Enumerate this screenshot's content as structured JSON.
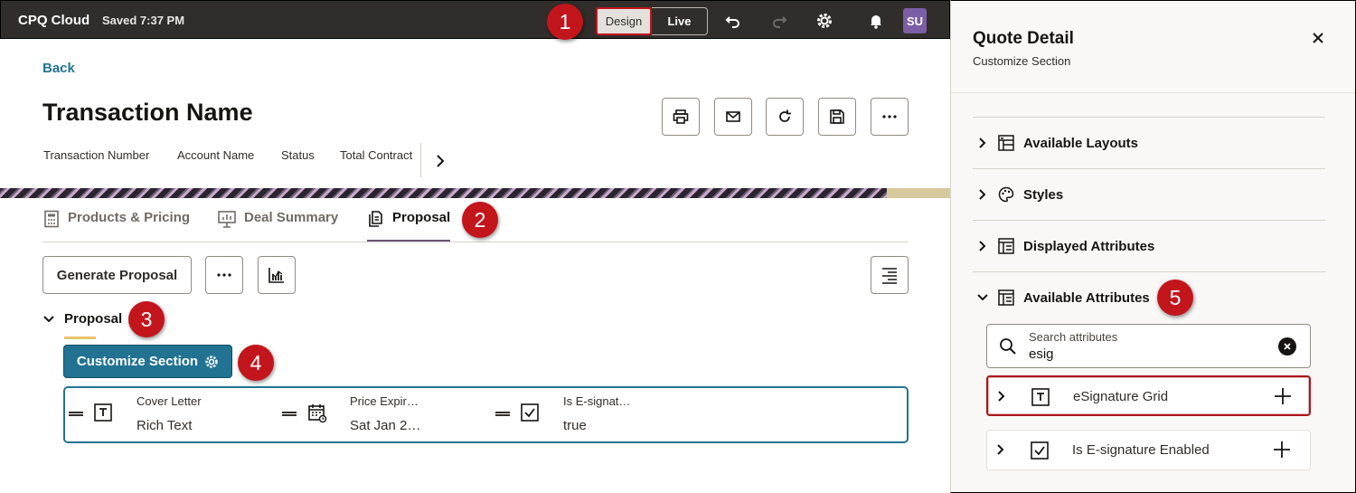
{
  "topbar": {
    "app_name": "CPQ Cloud",
    "saved_status": "Saved 7:37 PM",
    "design_label": "Design",
    "live_label": "Live",
    "avatar_initials": "SU",
    "icons": [
      "undo-icon",
      "redo-icon",
      "settings-icon",
      "bell-icon"
    ]
  },
  "badges": {
    "b1": "1",
    "b2": "2",
    "b3": "3",
    "b4": "4",
    "b5": "5"
  },
  "main": {
    "back_label": "Back",
    "title": "Transaction Name",
    "header_actions": [
      "print-icon",
      "email-icon",
      "refresh-icon",
      "save-icon",
      "more-icon"
    ],
    "meta_fields": [
      "Transaction Number",
      "Account Name",
      "Status",
      "Total Contract"
    ],
    "tabs": [
      {
        "label": "Products & Pricing",
        "icon": "calculator-icon"
      },
      {
        "label": "Deal Summary",
        "icon": "presentation-icon"
      },
      {
        "label": "Proposal",
        "icon": "document-icon",
        "active": true
      }
    ],
    "generate_label": "Generate Proposal",
    "section_title": "Proposal",
    "customize_label": "Customize Section",
    "fields": [
      {
        "label": "Cover Letter",
        "value": "Rich Text",
        "icon": "rich-text-icon"
      },
      {
        "label": "Price Expir…",
        "value": "Sat Jan 2…",
        "icon": "calendar-icon"
      },
      {
        "label": "Is E-signat…",
        "value": "true",
        "icon": "checkbox-icon"
      }
    ]
  },
  "panel": {
    "title": "Quote Detail",
    "subtitle": "Customize Section",
    "sections": [
      {
        "label": "Available Layouts",
        "icon": "layouts-icon",
        "expanded": false
      },
      {
        "label": "Styles",
        "icon": "palette-icon",
        "expanded": false
      },
      {
        "label": "Displayed Attributes",
        "icon": "attributes-icon",
        "expanded": false
      },
      {
        "label": "Available Attributes",
        "icon": "attributes-icon",
        "expanded": true
      }
    ],
    "search": {
      "placeholder": "Search attributes",
      "value": "esig"
    },
    "results": [
      {
        "label": "eSignature Grid",
        "icon": "rich-text-icon",
        "highlighted": true
      },
      {
        "label": "Is E-signature Enabled",
        "icon": "checkbox-icon",
        "highlighted": false
      }
    ]
  },
  "colors": {
    "topbar": "#312d2a",
    "accent": "#227392",
    "badge": "#c3151c",
    "tab_underline": "#6a5375"
  }
}
